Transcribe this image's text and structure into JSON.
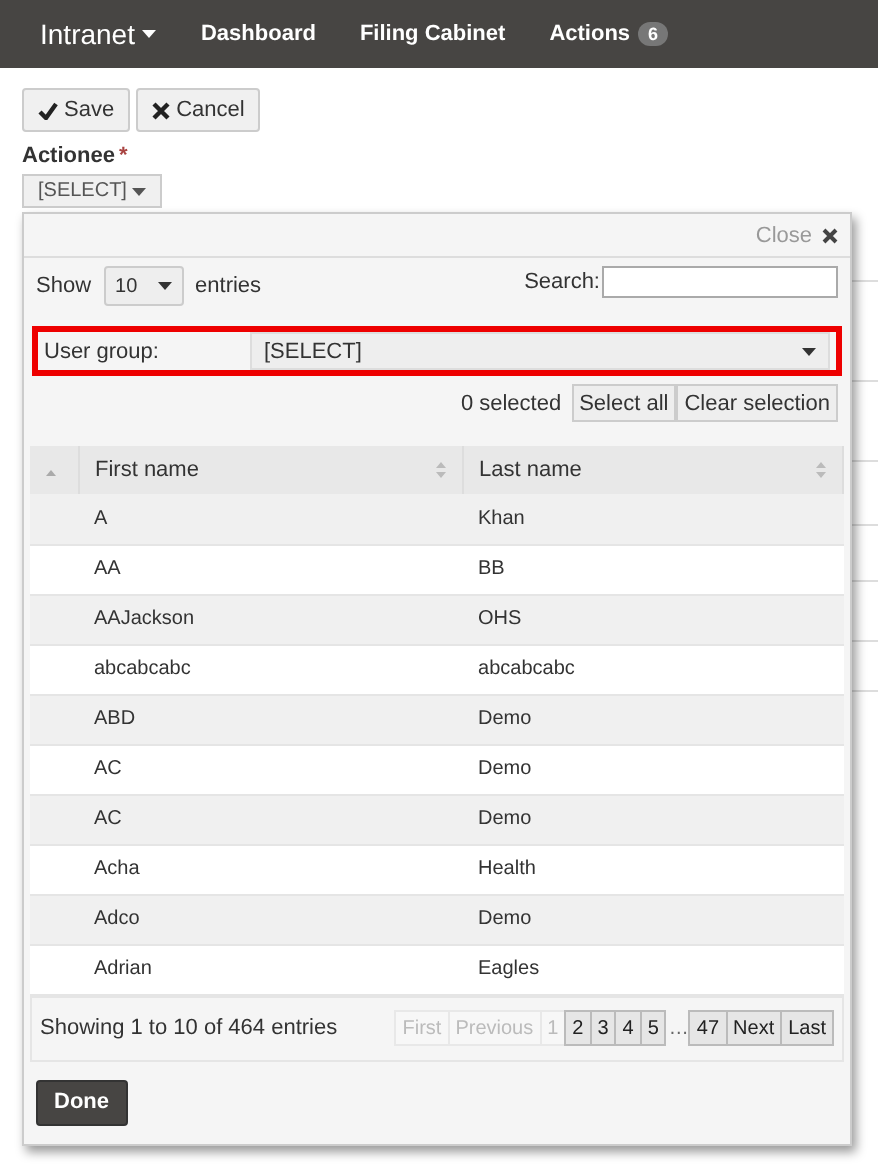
{
  "navbar": {
    "brand": "Intranet",
    "links": [
      {
        "label": "Dashboard"
      },
      {
        "label": "Filing Cabinet"
      },
      {
        "label": "Actions",
        "badge": "6"
      }
    ]
  },
  "toolbar": {
    "buttons": [
      {
        "kind": "save",
        "label": "Save"
      },
      {
        "kind": "cancel",
        "label": "Cancel"
      }
    ]
  },
  "actionee": {
    "label": "Actionee",
    "required_mark": "*",
    "value": "[SELECT]"
  },
  "dialog": {
    "close_label": "Close",
    "length": {
      "prefix": "Show",
      "value": "10",
      "suffix": "entries"
    },
    "search": {
      "label": "Search:"
    },
    "user_group": {
      "label": "User group:",
      "value": "[SELECT]",
      "highlighted": true
    },
    "selection": {
      "count": "0 selected",
      "buttons": [
        "Select all",
        "Clear selection"
      ]
    },
    "table": {
      "columns": [
        "First name",
        "Last name"
      ],
      "rows": [
        [
          "A",
          "Khan"
        ],
        [
          "AA",
          "BB"
        ],
        [
          "AAJackson",
          "OHS"
        ],
        [
          "abcabcabc",
          "abcabcabc"
        ],
        [
          "ABD",
          "Demo"
        ],
        [
          "AC",
          "Demo"
        ],
        [
          "AC",
          "Demo"
        ],
        [
          "Acha",
          "Health"
        ],
        [
          "Adco",
          "Demo"
        ],
        [
          "Adrian",
          "Eagles"
        ]
      ]
    },
    "info": "Showing 1 to 10 of 464 entries",
    "pagination": [
      {
        "label": "First",
        "disabled": true
      },
      {
        "label": "Previous",
        "disabled": true
      },
      {
        "label": "1",
        "disabled": true
      },
      {
        "label": "2",
        "disabled": false
      },
      {
        "label": "3",
        "disabled": false
      },
      {
        "label": "4",
        "disabled": false
      },
      {
        "label": "5",
        "disabled": false
      },
      {
        "label": "…",
        "kind": "ellipsis"
      },
      {
        "label": "47",
        "disabled": false
      },
      {
        "label": "Next",
        "disabled": false
      },
      {
        "label": "Last",
        "disabled": false
      }
    ],
    "done": "Done"
  }
}
